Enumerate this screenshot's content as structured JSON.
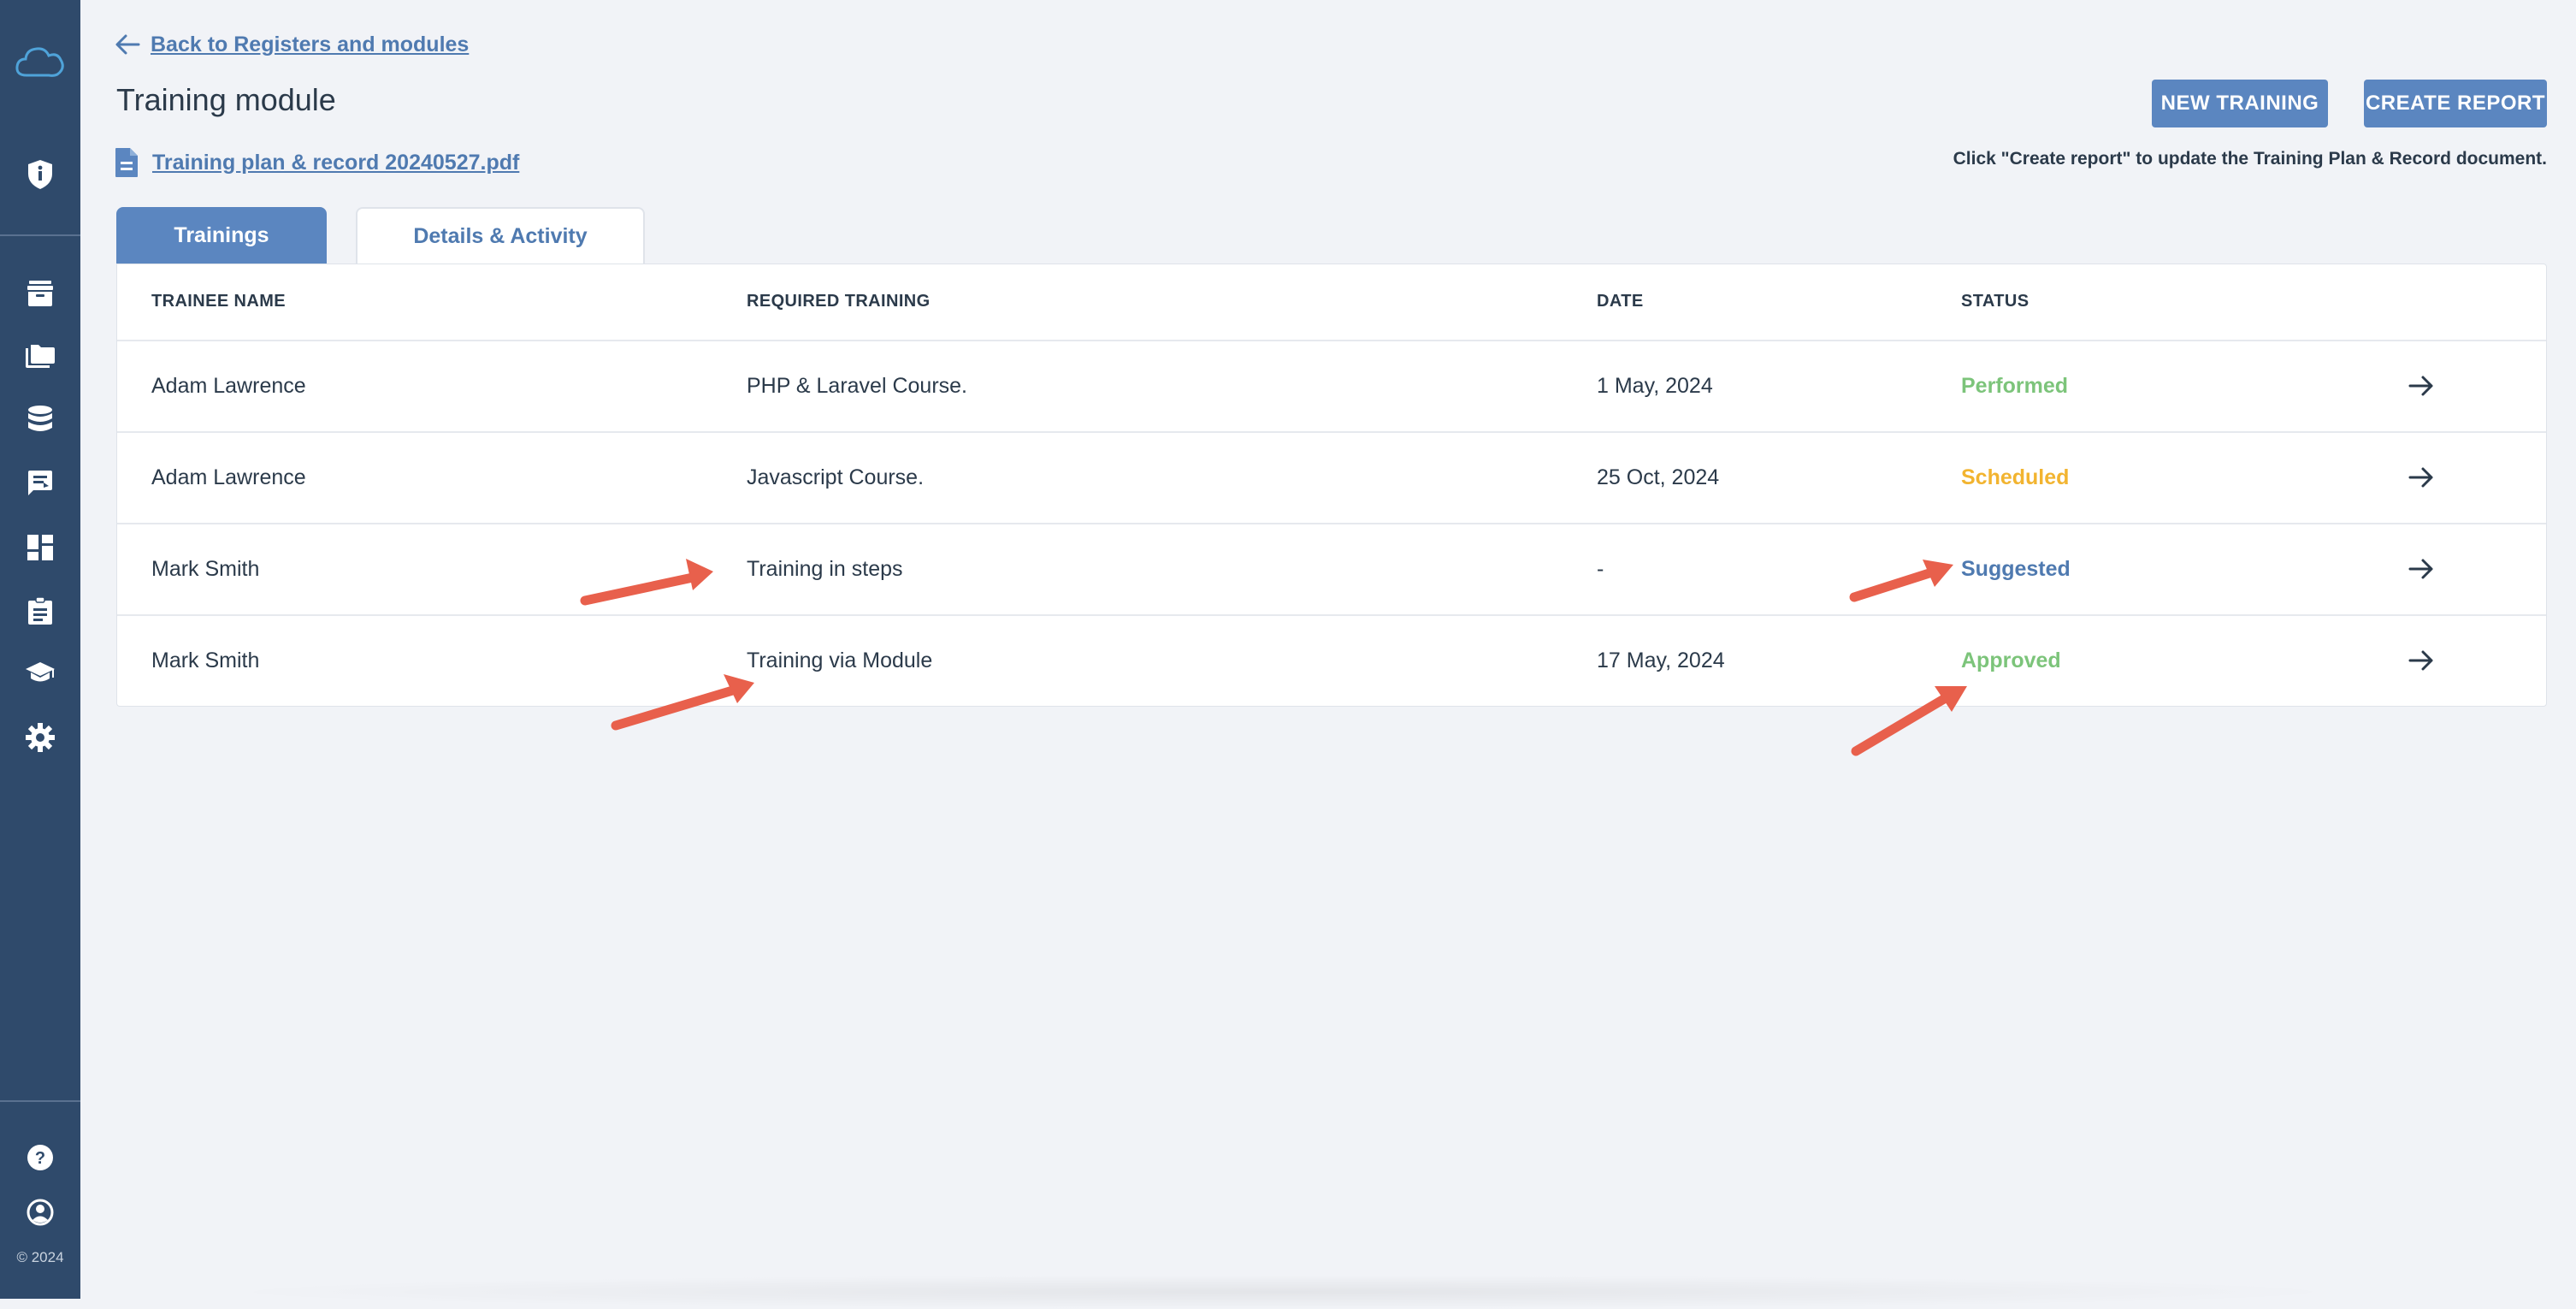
{
  "sidebar": {
    "icons": [
      "cloud-logo-icon",
      "shield-icon",
      "archive-icon",
      "folder-icon",
      "database-icon",
      "feedback-icon",
      "dashboard-icon",
      "clipboard-icon",
      "graduation-cap-icon",
      "gear-icon",
      "help-icon",
      "account-icon"
    ],
    "copyright": "© 2024"
  },
  "header": {
    "back_label": "Back to Registers and modules",
    "title": "Training module",
    "file_name": "Training plan & record 20240527.pdf",
    "new_training_label": "NEW TRAINING",
    "create_report_label": "CREATE REPORT",
    "hint": "Click \"Create report\" to update the Training Plan & Record document."
  },
  "tabs": [
    {
      "label": "Trainings",
      "active": true
    },
    {
      "label": "Details & Activity",
      "active": false
    }
  ],
  "table": {
    "columns": [
      "TRAINEE NAME",
      "REQUIRED TRAINING",
      "DATE",
      "STATUS"
    ],
    "rows": [
      {
        "trainee": "Adam Lawrence",
        "training": "PHP & Laravel Course.",
        "date": "1 May, 2024",
        "status": "Performed"
      },
      {
        "trainee": "Adam Lawrence",
        "training": "Javascript Course.",
        "date": "25 Oct, 2024",
        "status": "Scheduled"
      },
      {
        "trainee": "Mark Smith",
        "training": "Training in steps",
        "date": "-",
        "status": "Suggested"
      },
      {
        "trainee": "Mark Smith",
        "training": "Training via Module",
        "date": "17 May, 2024",
        "status": "Approved"
      }
    ]
  },
  "colors": {
    "sidebar": "#2f4a6b",
    "accent": "#5b86c0",
    "performed": "#7cc47a",
    "scheduled": "#f2b430",
    "suggested": "#4f7ab0",
    "approved": "#7cc47a",
    "annotation_arrow": "#e8604c"
  }
}
